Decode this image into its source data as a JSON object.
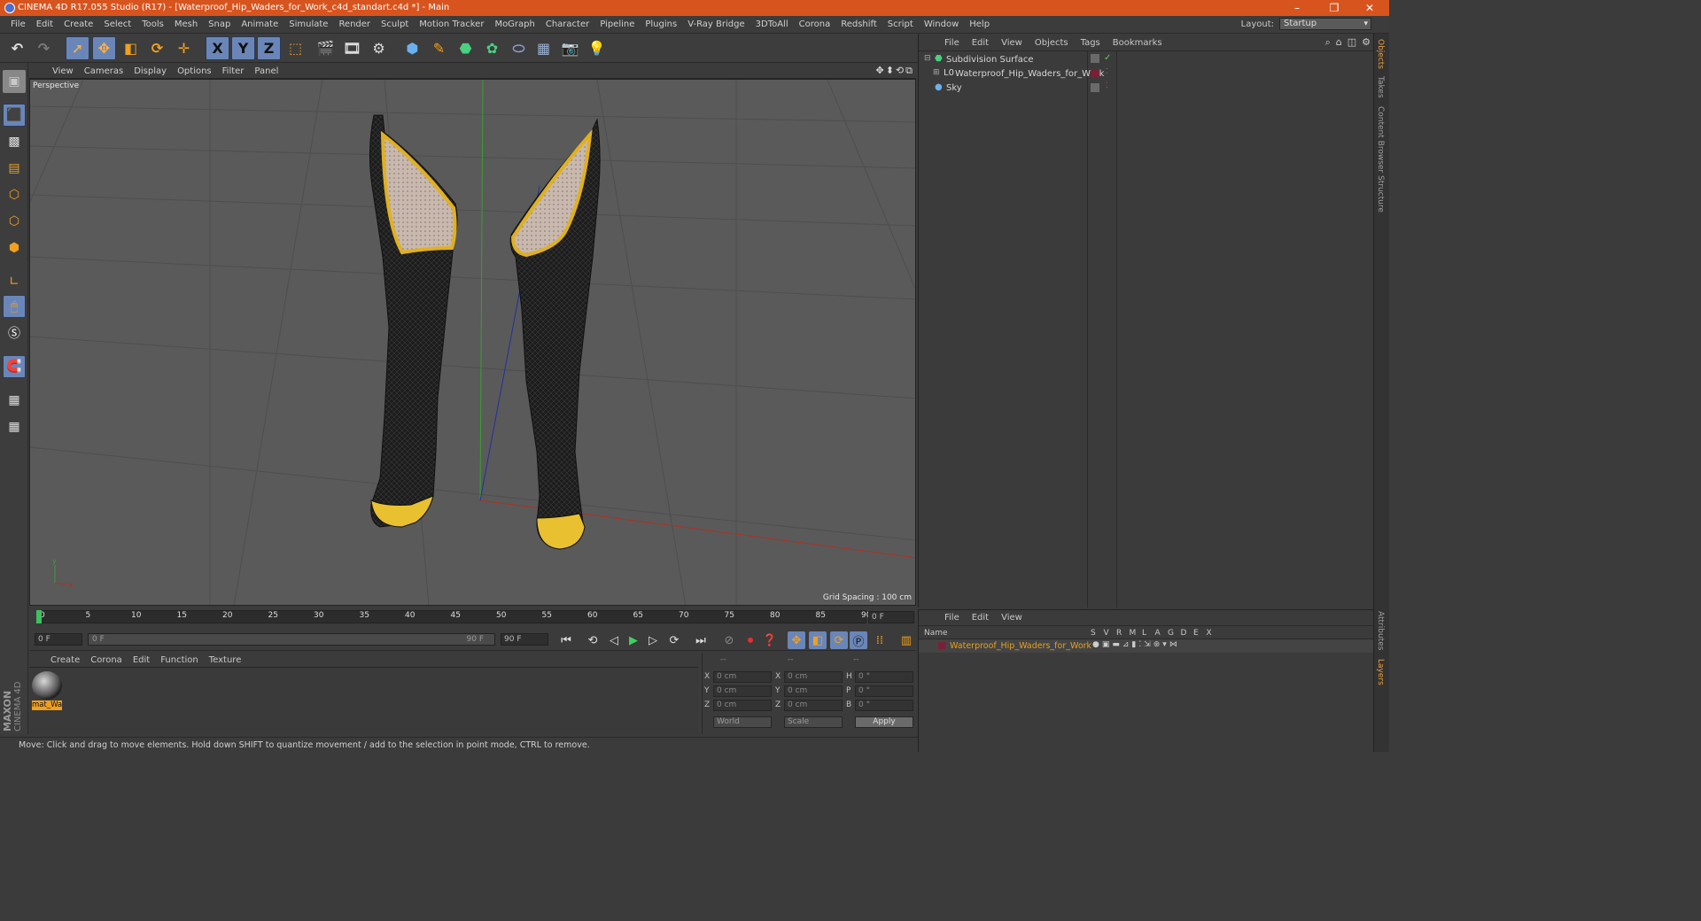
{
  "titlebar": {
    "title": "CINEMA 4D R17.055 Studio (R17) - [Waterproof_Hip_Waders_for_Work_c4d_standart.c4d *] - Main"
  },
  "menubar": {
    "items": [
      "File",
      "Edit",
      "Create",
      "Select",
      "Tools",
      "Mesh",
      "Snap",
      "Animate",
      "Simulate",
      "Render",
      "Sculpt",
      "Motion Tracker",
      "MoGraph",
      "Character",
      "Pipeline",
      "Plugins",
      "V-Ray Bridge",
      "3DToAll",
      "Corona",
      "Redshift",
      "Script",
      "Window",
      "Help"
    ],
    "layout_label": "Layout:",
    "layout_value": "Startup"
  },
  "toolbar": {
    "axis_x": "X",
    "axis_y": "Y",
    "axis_z": "Z"
  },
  "viewport": {
    "menu": [
      "View",
      "Cameras",
      "Display",
      "Options",
      "Filter",
      "Panel"
    ],
    "label": "Perspective",
    "grid_spacing": "Grid Spacing : 100 cm",
    "axis_y": "y",
    "axis_x": "x"
  },
  "timeline": {
    "ticks": [
      "0",
      "5",
      "10",
      "15",
      "20",
      "25",
      "30",
      "35",
      "40",
      "45",
      "50",
      "55",
      "60",
      "65",
      "70",
      "75",
      "80",
      "85",
      "90"
    ],
    "current_frame": "0 F",
    "start_field": "0 F",
    "range_start": "0 F",
    "range_end": "90 F",
    "end_field": "90 F"
  },
  "material_manager": {
    "menu": [
      "Create",
      "Corona",
      "Edit",
      "Function",
      "Texture"
    ],
    "material_name": "mat_Wa"
  },
  "coordinates": {
    "header": [
      "--",
      "--",
      "--"
    ],
    "rows": [
      {
        "a": "X",
        "av": "0 cm",
        "b": "X",
        "bv": "0 cm",
        "c": "H",
        "cv": "0 °"
      },
      {
        "a": "Y",
        "av": "0 cm",
        "b": "Y",
        "bv": "0 cm",
        "c": "P",
        "cv": "0 °"
      },
      {
        "a": "Z",
        "av": "0 cm",
        "b": "Z",
        "bv": "0 cm",
        "c": "B",
        "cv": "0 °"
      }
    ],
    "world": "World",
    "scale": "Scale",
    "apply": "Apply"
  },
  "status": {
    "text": "Move: Click and drag to move elements. Hold down SHIFT to quantize movement / add to the selection in point mode, CTRL to remove."
  },
  "brand": {
    "maxon": "MAXON",
    "cinema": "CINEMA 4D"
  },
  "objects_panel": {
    "menu": [
      "File",
      "Edit",
      "View",
      "Objects",
      "Tags",
      "Bookmarks"
    ],
    "objects": [
      "Subdivision Surface",
      "Waterproof_Hip_Waders_for_Work",
      "Sky"
    ]
  },
  "layers_panel": {
    "menu": [
      "File",
      "Edit",
      "View"
    ],
    "name_header": "Name",
    "columns": [
      "S",
      "V",
      "R",
      "M",
      "L",
      "A",
      "G",
      "D",
      "E",
      "X"
    ],
    "layer_name": "Waterproof_Hip_Waders_for_Work"
  },
  "side_tabs": [
    "Objects",
    "Takes",
    "Content Browser",
    "Structure",
    "Attributes",
    "Layers"
  ],
  "colors": {
    "accent": "#d8541e",
    "selected_tool": "#6a86b8",
    "layer_text": "#e8a020",
    "layer_color": "#7a1f3a"
  }
}
